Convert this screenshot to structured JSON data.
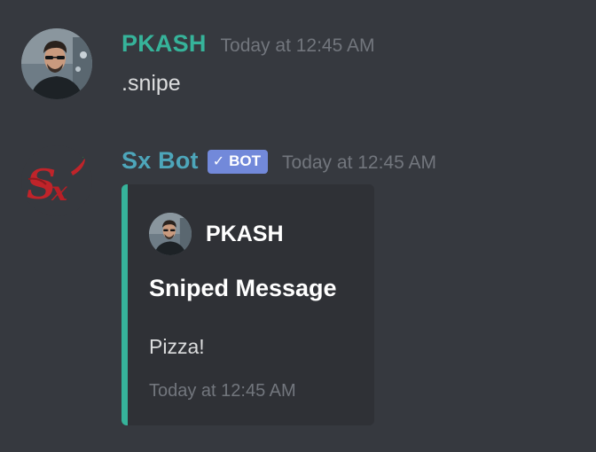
{
  "messages": [
    {
      "author": "PKASH",
      "timestamp": "Today at 12:45 AM",
      "content": ".snipe",
      "author_color": "#36b39a",
      "avatar_icon": "man-photo-avatar"
    },
    {
      "author": "Sx Bot",
      "bot_tag": "BOT",
      "bot_tag_icon": "checkmark-icon",
      "timestamp": "Today at 12:45 AM",
      "author_color": "#4da6ba",
      "avatar_icon": "chili-sx-logo",
      "embed": {
        "accent_color": "#36b39a",
        "author_name": "PKASH",
        "title": "Sniped Message",
        "description": "Pizza!",
        "footer": "Today at 12:45 AM"
      }
    }
  ],
  "colors": {
    "background": "#36393f",
    "embed_background": "#2f3136",
    "bot_tag": "#7289da",
    "muted_text": "#72767d"
  }
}
